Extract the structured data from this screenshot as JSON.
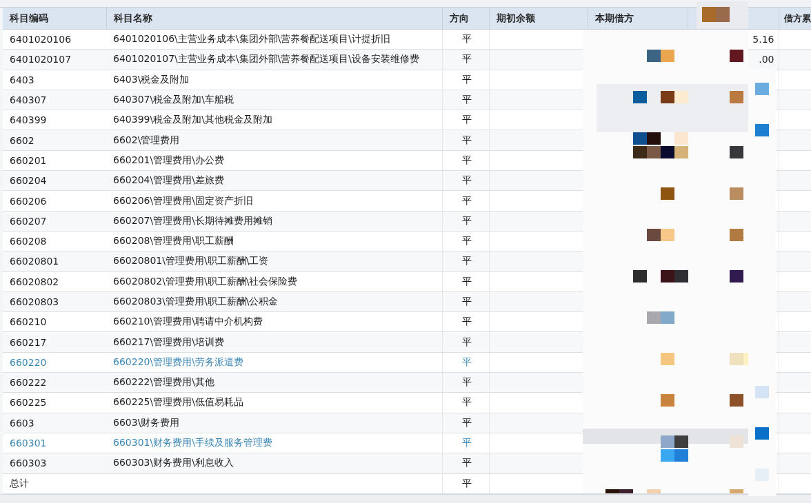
{
  "table": {
    "columns": [
      "科目编码",
      "科目名称",
      "方向",
      "期初余额",
      "本期借方",
      "借方累"
    ],
    "rows": [
      {
        "code": "6401020106",
        "name": "6401020106\\主营业务成本\\集团外部\\营养餐配送项目\\计提折旧",
        "direction": "平",
        "column_6": "5.16",
        "highlighted": false
      },
      {
        "code": "6401020107",
        "name": "6401020107\\主营业务成本\\集团外部\\营养餐配送项目\\设备安装维修费",
        "direction": "平",
        "column_6": ".00",
        "highlighted": false
      },
      {
        "code": "6403",
        "name": "6403\\税金及附加",
        "direction": "平",
        "highlighted": false
      },
      {
        "code": "640307",
        "name": "640307\\税金及附加\\车船税",
        "direction": "平",
        "highlighted": false
      },
      {
        "code": "640399",
        "name": "640399\\税金及附加\\其他税金及附加",
        "direction": "平",
        "highlighted": false
      },
      {
        "code": "6602",
        "name": "6602\\管理费用",
        "direction": "平",
        "highlighted": false
      },
      {
        "code": "660201",
        "name": "660201\\管理费用\\办公费",
        "direction": "平",
        "highlighted": false
      },
      {
        "code": "660204",
        "name": "660204\\管理费用\\差旅费",
        "direction": "平",
        "highlighted": false
      },
      {
        "code": "660206",
        "name": "660206\\管理费用\\固定资产折旧",
        "direction": "平",
        "highlighted": false
      },
      {
        "code": "660207",
        "name": "660207\\管理费用\\长期待摊费用摊销",
        "direction": "平",
        "highlighted": false
      },
      {
        "code": "660208",
        "name": "660208\\管理费用\\职工薪酬",
        "direction": "平",
        "highlighted": false
      },
      {
        "code": "66020801",
        "name": "66020801\\管理费用\\职工薪酬\\工资",
        "direction": "平",
        "highlighted": false
      },
      {
        "code": "66020802",
        "name": "66020802\\管理费用\\职工薪酬\\社会保险费",
        "direction": "平",
        "highlighted": false
      },
      {
        "code": "66020803",
        "name": "66020803\\管理费用\\职工薪酬\\公积金",
        "direction": "平",
        "highlighted": false
      },
      {
        "code": "660210",
        "name": "660210\\管理费用\\聘请中介机构费",
        "direction": "平",
        "highlighted": false
      },
      {
        "code": "660217",
        "name": "660217\\管理费用\\培训费",
        "direction": "平",
        "highlighted": false
      },
      {
        "code": "660220",
        "name": "660220\\管理费用\\劳务派遣费",
        "direction": "平",
        "highlighted": true
      },
      {
        "code": "660222",
        "name": "660222\\管理费用\\其他",
        "direction": "平",
        "highlighted": false
      },
      {
        "code": "660225",
        "name": "660225\\管理费用\\低值易耗品",
        "direction": "平",
        "highlighted": false
      },
      {
        "code": "6603",
        "name": "6603\\财务费用",
        "direction": "平",
        "highlighted": false
      },
      {
        "code": "660301",
        "name": "660301\\财务费用\\手续及服务管理费",
        "direction": "平",
        "highlighted": true
      },
      {
        "code": "660303",
        "name": "660303\\财务费用\\利息收入",
        "direction": "平",
        "highlighted": false
      }
    ],
    "total": {
      "label": "总计",
      "direction": "平"
    }
  }
}
